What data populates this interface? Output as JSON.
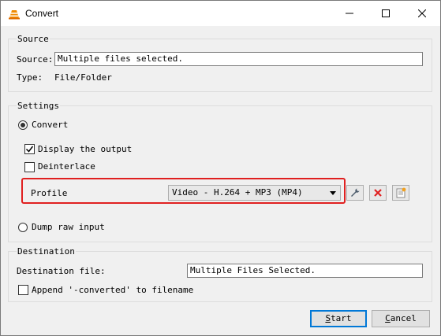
{
  "window": {
    "title": "Convert"
  },
  "source": {
    "group_title": "Source",
    "source_label": "Source:",
    "source_value": "Multiple files selected.",
    "type_label": "Type:",
    "type_value": "File/Folder"
  },
  "settings": {
    "group_title": "Settings",
    "convert_label": "Convert",
    "convert_selected": true,
    "display_output_label": "Display the output",
    "display_output_checked": true,
    "deinterlace_label": "Deinterlace",
    "deinterlace_checked": false,
    "profile_label": "Profile",
    "profile_value": "Video - H.264 + MP3 (MP4)",
    "dump_raw_label": "Dump raw input",
    "dump_raw_selected": false
  },
  "destination": {
    "group_title": "Destination",
    "file_label": "Destination file:",
    "file_value": "Multiple Files Selected.",
    "append_label": "Append '-converted' to filename",
    "append_checked": false
  },
  "buttons": {
    "start_first": "S",
    "start_rest": "tart",
    "cancel_first": "C",
    "cancel_rest": "ancel"
  },
  "colors": {
    "highlight": "#e02020",
    "default_button_border": "#0078d7",
    "delete_icon": "#e02020"
  }
}
